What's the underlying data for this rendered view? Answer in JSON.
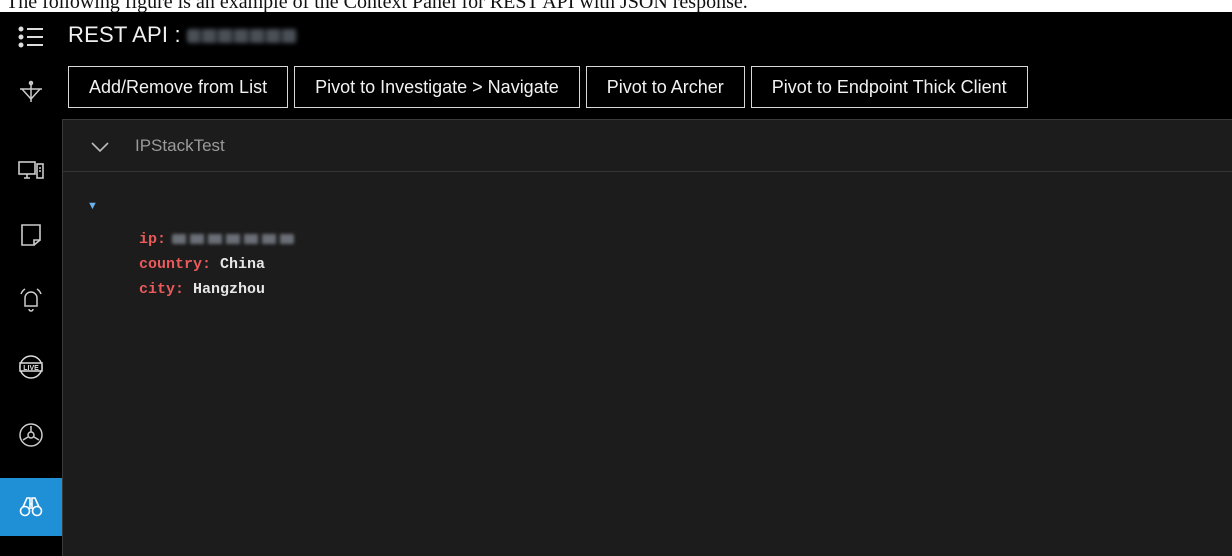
{
  "caption": "The following figure is an example of the Context Panel for REST API with JSON response.",
  "header": {
    "title": "REST API :"
  },
  "toolbar": {
    "buttons": [
      "Add/Remove from List",
      "Pivot to Investigate > Navigate",
      "Pivot to Archer",
      "Pivot to Endpoint Thick Client"
    ]
  },
  "panel": {
    "title": "IPStackTest",
    "fields": [
      {
        "key": "ip",
        "value": ""
      },
      {
        "key": "country",
        "value": "China"
      },
      {
        "key": "city",
        "value": "Hangzhou"
      }
    ]
  },
  "nav": {
    "items": [
      "menu-icon",
      "investigate-icon",
      "hosts-icon",
      "files-icon",
      "alerts-icon",
      "live-icon",
      "biohazard-icon",
      "binoculars-icon"
    ],
    "active": "binoculars-icon",
    "active_color": "#1f8fd6"
  },
  "colors": {
    "key": "#ea5a5a",
    "value": "#e6e6e6",
    "toggle": "#6ab3ee"
  }
}
